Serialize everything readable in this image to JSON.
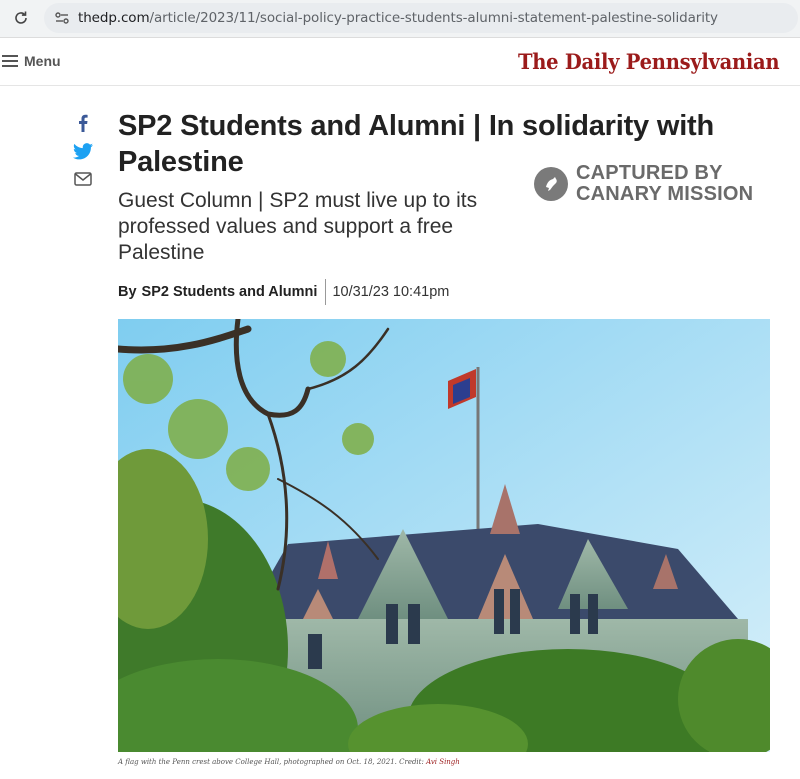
{
  "browser": {
    "url_host": "thedp.com",
    "url_path": "/article/2023/11/social-policy-practice-students-alumni-statement-palestine-solidarity",
    "icons": {
      "reload": "reload-icon",
      "site_info": "site-info-icon"
    }
  },
  "header": {
    "menu_label": "Menu",
    "logo_text": "The Daily Pennsylvanian",
    "brand_color": "#9b1b1b"
  },
  "social": {
    "icons": [
      "facebook-icon",
      "twitter-icon",
      "email-icon"
    ],
    "colors": {
      "facebook": "#3b5998",
      "twitter": "#1da1f2",
      "email": "#555555"
    }
  },
  "article": {
    "title": "SP2 Students and Alumni | In solidarity with Palestine",
    "subtitle": "Guest Column | SP2 must live up to its professed values and support a free Palestine",
    "byline_prefix": "By",
    "author": "SP2 Students and Alumni",
    "date": "10/31/23 10:41pm"
  },
  "watermark": {
    "line1": "CAPTURED BY",
    "line2": "CANARY MISSION"
  },
  "photo": {
    "caption": "A flag with the Penn crest above College Hall, photographed on Oct. 18, 2021. Credit: ",
    "credit": "Avi Singh"
  }
}
